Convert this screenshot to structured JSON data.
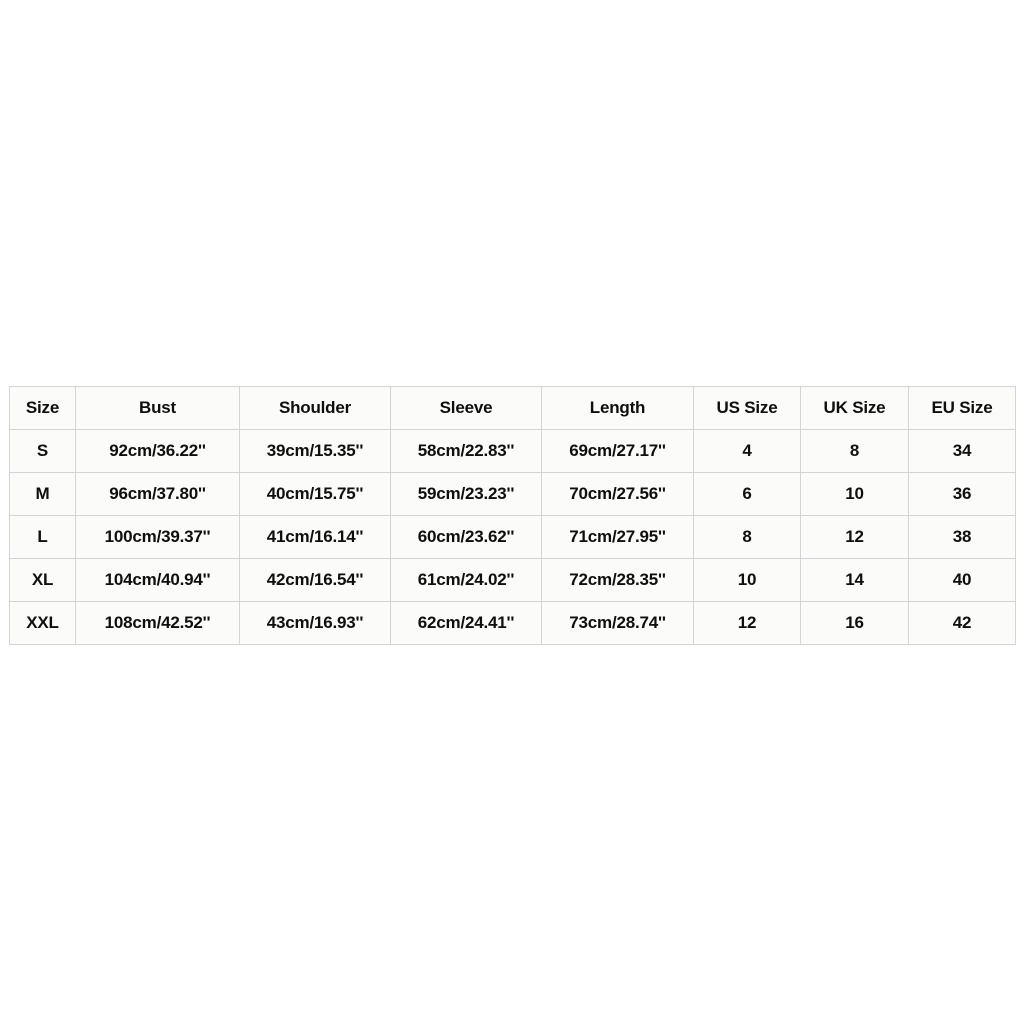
{
  "table": {
    "headers": [
      "Size",
      "Bust",
      "Shoulder",
      "Sleeve",
      "Length",
      "US Size",
      "UK Size",
      "EU Size"
    ],
    "rows": [
      {
        "size": "S",
        "bust": "92cm/36.22''",
        "shoulder": "39cm/15.35''",
        "sleeve": "58cm/22.83''",
        "length": "69cm/27.17''",
        "us_size": "4",
        "uk_size": "8",
        "eu_size": "34"
      },
      {
        "size": "M",
        "bust": "96cm/37.80''",
        "shoulder": "40cm/15.75''",
        "sleeve": "59cm/23.23''",
        "length": "70cm/27.56''",
        "us_size": "6",
        "uk_size": "10",
        "eu_size": "36"
      },
      {
        "size": "L",
        "bust": "100cm/39.37''",
        "shoulder": "41cm/16.14''",
        "sleeve": "60cm/23.62''",
        "length": "71cm/27.95''",
        "us_size": "8",
        "uk_size": "12",
        "eu_size": "38"
      },
      {
        "size": "XL",
        "bust": "104cm/40.94''",
        "shoulder": "42cm/16.54''",
        "sleeve": "61cm/24.02''",
        "length": "72cm/28.35''",
        "us_size": "10",
        "uk_size": "14",
        "eu_size": "40"
      },
      {
        "size": "XXL",
        "bust": "108cm/42.52''",
        "shoulder": "43cm/16.93''",
        "sleeve": "62cm/24.41''",
        "length": "73cm/28.74''",
        "us_size": "12",
        "uk_size": "16",
        "eu_size": "42"
      }
    ]
  },
  "colors": {
    "page_background": "#ffffff",
    "cell_background": "#fbfbf9",
    "border": "#d4d4d4",
    "text": "#100f0f"
  }
}
